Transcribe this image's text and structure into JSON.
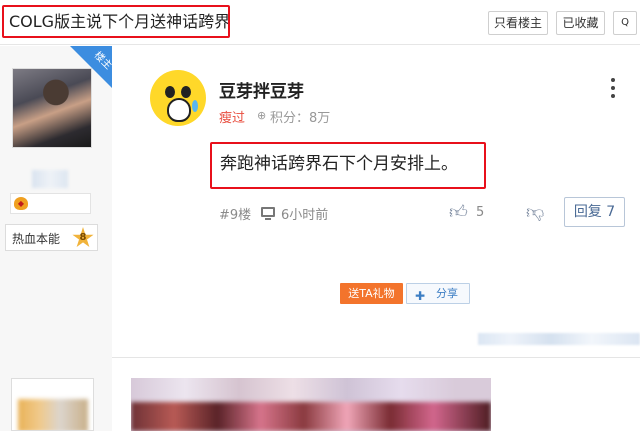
{
  "thread": {
    "title": "COLG版主说下个月送神话跨界",
    "only_author_label": "只看楼主",
    "favorited_label": "已收藏",
    "more_label": "Q"
  },
  "author_panel": {
    "badge": "楼主",
    "level_label": "热血本能",
    "level_value": "8"
  },
  "post": {
    "author_name": "豆芽拌豆芽",
    "rank": "瘦过",
    "score_icon": "⊕",
    "score_label": "积分",
    "score": "积分：8万",
    "content": "奔跑神话跨界石下个月安排上。",
    "floor": "#9楼",
    "time": "6小时前",
    "likes": "5",
    "reply_label": "回复 7",
    "gift_label": "送TA礼物",
    "share_label": "分享"
  },
  "icons": {
    "like": "thumbs-up-icon",
    "dislike": "thumbs-down-icon",
    "more": "vertical-dots-icon",
    "time": "monitor-icon",
    "share": "plus-cross-icon"
  },
  "colors": {
    "highlight_border": "#e8101b",
    "rank_red": "#e84c3d",
    "gift_orange": "#f3742c",
    "link_blue": "#3c7ec4",
    "badge_blue": "#3c8de0"
  }
}
